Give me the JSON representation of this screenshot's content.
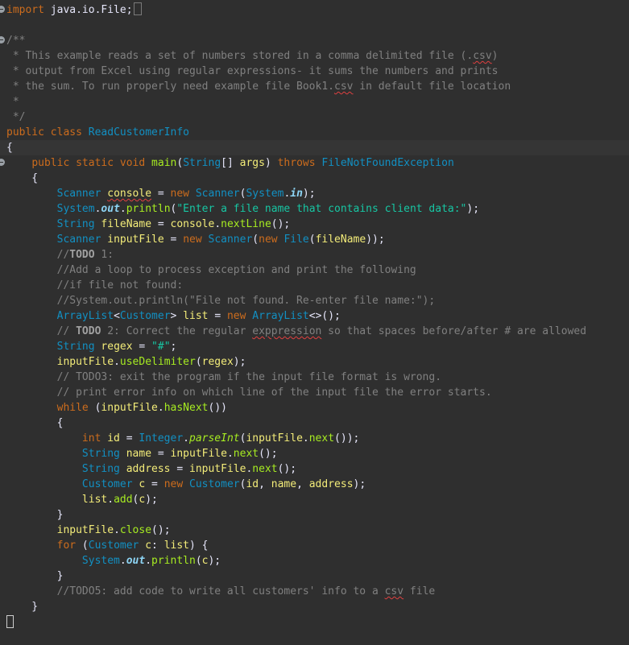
{
  "editor": {
    "lines": {
      "l0": [
        "import",
        " java.io.File;"
      ],
      "l2": [
        "/**"
      ],
      "l3": [
        " * This example reads a set of numbers stored in a comma delimited file (.",
        "csv",
        ")"
      ],
      "l4": [
        " * output from Excel using regular expressions- it sums the numbers and prints"
      ],
      "l5": [
        " * the sum. To run properly need example file Book1.",
        "csv",
        " in default file location"
      ],
      "l6": [
        " *"
      ],
      "l7": [
        " */"
      ],
      "l8": [
        "public",
        " ",
        "class",
        " ",
        "ReadCustomerInfo"
      ],
      "l9": [
        "{"
      ],
      "l10": [
        "    ",
        "public",
        " ",
        "static",
        " ",
        "void",
        " ",
        "main",
        "(",
        "String",
        "[] ",
        "args",
        ") ",
        "throws",
        " ",
        "FileNotFoundException"
      ],
      "l11": [
        "    {"
      ],
      "l12": [
        "        ",
        "Scanner",
        " ",
        "console",
        " = ",
        "new",
        " ",
        "Scanner",
        "(",
        "System",
        ".",
        "in",
        ");"
      ],
      "l13": [
        "        ",
        "System",
        ".",
        "out",
        ".",
        "println",
        "(",
        "\"Enter a file name that contains client data:\"",
        ");"
      ],
      "l14": [
        "        ",
        "String",
        " ",
        "fileName",
        " = ",
        "console",
        ".",
        "nextLine",
        "();"
      ],
      "l15": [
        "        ",
        "Scanner",
        " ",
        "inputFile",
        " = ",
        "new",
        " ",
        "Scanner",
        "(",
        "new",
        " ",
        "File",
        "(",
        "fileName",
        "));"
      ],
      "l16": [
        "        //",
        "TODO",
        " 1:"
      ],
      "l17": [
        "        //Add a loop to process exception and print the following"
      ],
      "l18": [
        "        //if file not found:"
      ],
      "l19": [
        "        //System.out.println(\"File not found. Re-enter file name:\");"
      ],
      "l20": [
        "        ",
        "ArrayList",
        "<",
        "Customer",
        "> ",
        "list",
        " = ",
        "new",
        " ",
        "ArrayList",
        "<>();"
      ],
      "l21": [
        "        // ",
        "TODO",
        " 2: Correct the regular ",
        "exppression",
        " so that spaces before/after # are allowed"
      ],
      "l22": [
        "        ",
        "String",
        " ",
        "regex",
        " = ",
        "\"#\"",
        ";"
      ],
      "l23": [
        "        ",
        "inputFile",
        ".",
        "useDelimiter",
        "(",
        "regex",
        ");"
      ],
      "l24": [
        "        // TODO3: exit the program if the input file format is wrong."
      ],
      "l25": [
        "        // print error info on which line of the input file the error starts."
      ],
      "l26": [
        "        ",
        "while",
        " (",
        "inputFile",
        ".",
        "hasNext",
        "())"
      ],
      "l27": [
        "        {"
      ],
      "l28": [
        "            ",
        "int",
        " ",
        "id",
        " = ",
        "Integer",
        ".",
        "parseInt",
        "(",
        "inputFile",
        ".",
        "next",
        "());"
      ],
      "l29": [
        "            ",
        "String",
        " ",
        "name",
        " = ",
        "inputFile",
        ".",
        "next",
        "();"
      ],
      "l30": [
        "            ",
        "String",
        " ",
        "address",
        " = ",
        "inputFile",
        ".",
        "next",
        "();"
      ],
      "l31": [
        "            ",
        "Customer",
        " ",
        "c",
        " = ",
        "new",
        " ",
        "Customer",
        "(",
        "id",
        ", ",
        "name",
        ", ",
        "address",
        ");"
      ],
      "l32": [
        "            ",
        "list",
        ".",
        "add",
        "(",
        "c",
        ");"
      ],
      "l33": [
        "        }"
      ],
      "l34": [
        "        ",
        "inputFile",
        ".",
        "close",
        "();"
      ],
      "l35": [
        "        ",
        "for",
        " (",
        "Customer",
        " ",
        "c",
        ": ",
        "list",
        ") {"
      ],
      "l36": [
        "            ",
        "System",
        ".",
        "out",
        ".",
        "println",
        "(",
        "c",
        ");"
      ],
      "l37": [
        "        }"
      ],
      "l38": [
        "        //TODO5: add code to write all customers' info to a ",
        "csv",
        " file"
      ],
      "l39": [
        "    }"
      ]
    }
  }
}
